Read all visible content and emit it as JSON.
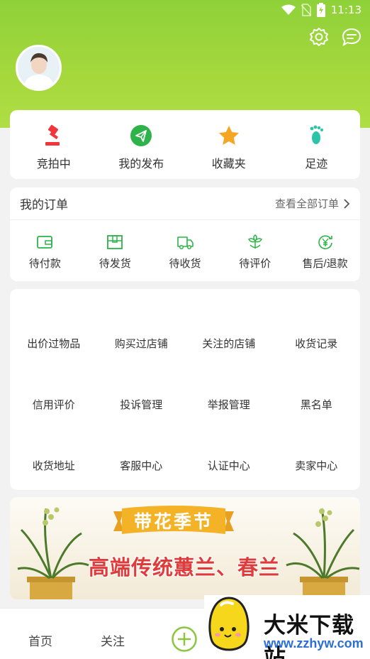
{
  "status_bar": {
    "time": "11:13"
  },
  "top_actions": {
    "settings_icon": "gear-icon",
    "messages_icon": "chat-bubble-icon"
  },
  "quick_actions": [
    {
      "label": "竞拍中",
      "icon": "auction-hammer-icon",
      "color": "#f0353b"
    },
    {
      "label": "我的发布",
      "icon": "paper-plane-icon",
      "color": "#2db34a"
    },
    {
      "label": "收藏夹",
      "icon": "star-icon",
      "color": "#f5a623"
    },
    {
      "label": "足迹",
      "icon": "footprint-icon",
      "color": "#2bc4a8"
    }
  ],
  "orders": {
    "title": "我的订单",
    "view_all": "查看全部订单",
    "items": [
      {
        "label": "待付款",
        "icon": "wallet-icon"
      },
      {
        "label": "待发货",
        "icon": "package-icon"
      },
      {
        "label": "待收货",
        "icon": "truck-icon"
      },
      {
        "label": "待评价",
        "icon": "flower-icon"
      },
      {
        "label": "售后/退款",
        "icon": "yen-refund-icon"
      }
    ]
  },
  "services": [
    [
      "出价过物品",
      "购买过店铺",
      "关注的店铺",
      "收货记录"
    ],
    [
      "信用评价",
      "投诉管理",
      "举报管理",
      "黑名单"
    ],
    [
      "收货地址",
      "客服中心",
      "认证中心",
      "卖家中心"
    ]
  ],
  "banner": {
    "ribbon": "带花季节",
    "headline": "高端传统蕙兰、春兰"
  },
  "bottom_nav": {
    "home": "首页",
    "follow": "关注",
    "add_icon": "plus-circle-icon"
  },
  "watermark": {
    "title": "大米下载站",
    "url": "www.zzhyw.com"
  },
  "colors": {
    "accent": "#8fd13a",
    "nav_accent": "#8cc63f"
  }
}
